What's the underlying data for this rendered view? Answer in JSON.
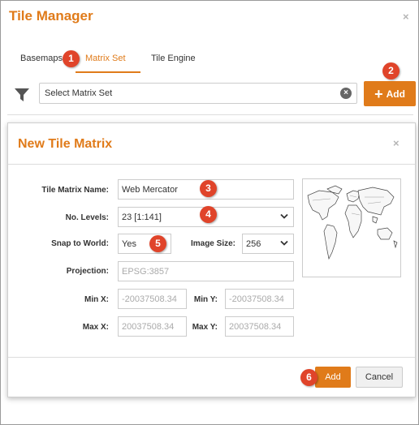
{
  "window": {
    "title": "Tile Manager",
    "close_icon": "×"
  },
  "tabs": [
    {
      "label": "Basemaps",
      "active": false
    },
    {
      "label": "Matrix Set",
      "active": true
    },
    {
      "label": "Tile Engine",
      "active": false
    }
  ],
  "toolbar": {
    "search_value": "Select Matrix Set",
    "clear_icon": "×",
    "add_label": "Add",
    "add_icon": "+"
  },
  "modal": {
    "title": "New Tile Matrix",
    "close_icon": "×",
    "fields": {
      "name": {
        "label": "Tile Matrix Name:",
        "value": "Web Mercator"
      },
      "levels": {
        "label": "No. Levels:",
        "value": "23  [1:141]"
      },
      "snap": {
        "label": "Snap to World:",
        "value": "Yes"
      },
      "image_size": {
        "label": "Image Size:",
        "value": "256"
      },
      "projection": {
        "label": "Projection:",
        "value": "EPSG:3857"
      },
      "min_x": {
        "label": "Min X:",
        "value": "-20037508.34"
      },
      "min_y": {
        "label": "Min Y:",
        "value": "-20037508.34"
      },
      "max_x": {
        "label": "Max X:",
        "value": "20037508.34"
      },
      "max_y": {
        "label": "Max Y:",
        "value": "20037508.34"
      }
    },
    "buttons": {
      "add": "Add",
      "cancel": "Cancel"
    }
  },
  "callouts": [
    "1",
    "2",
    "3",
    "4",
    "5",
    "6"
  ],
  "colors": {
    "accent": "#e07b1a",
    "callout": "#e0442a",
    "border": "#cccccc"
  }
}
